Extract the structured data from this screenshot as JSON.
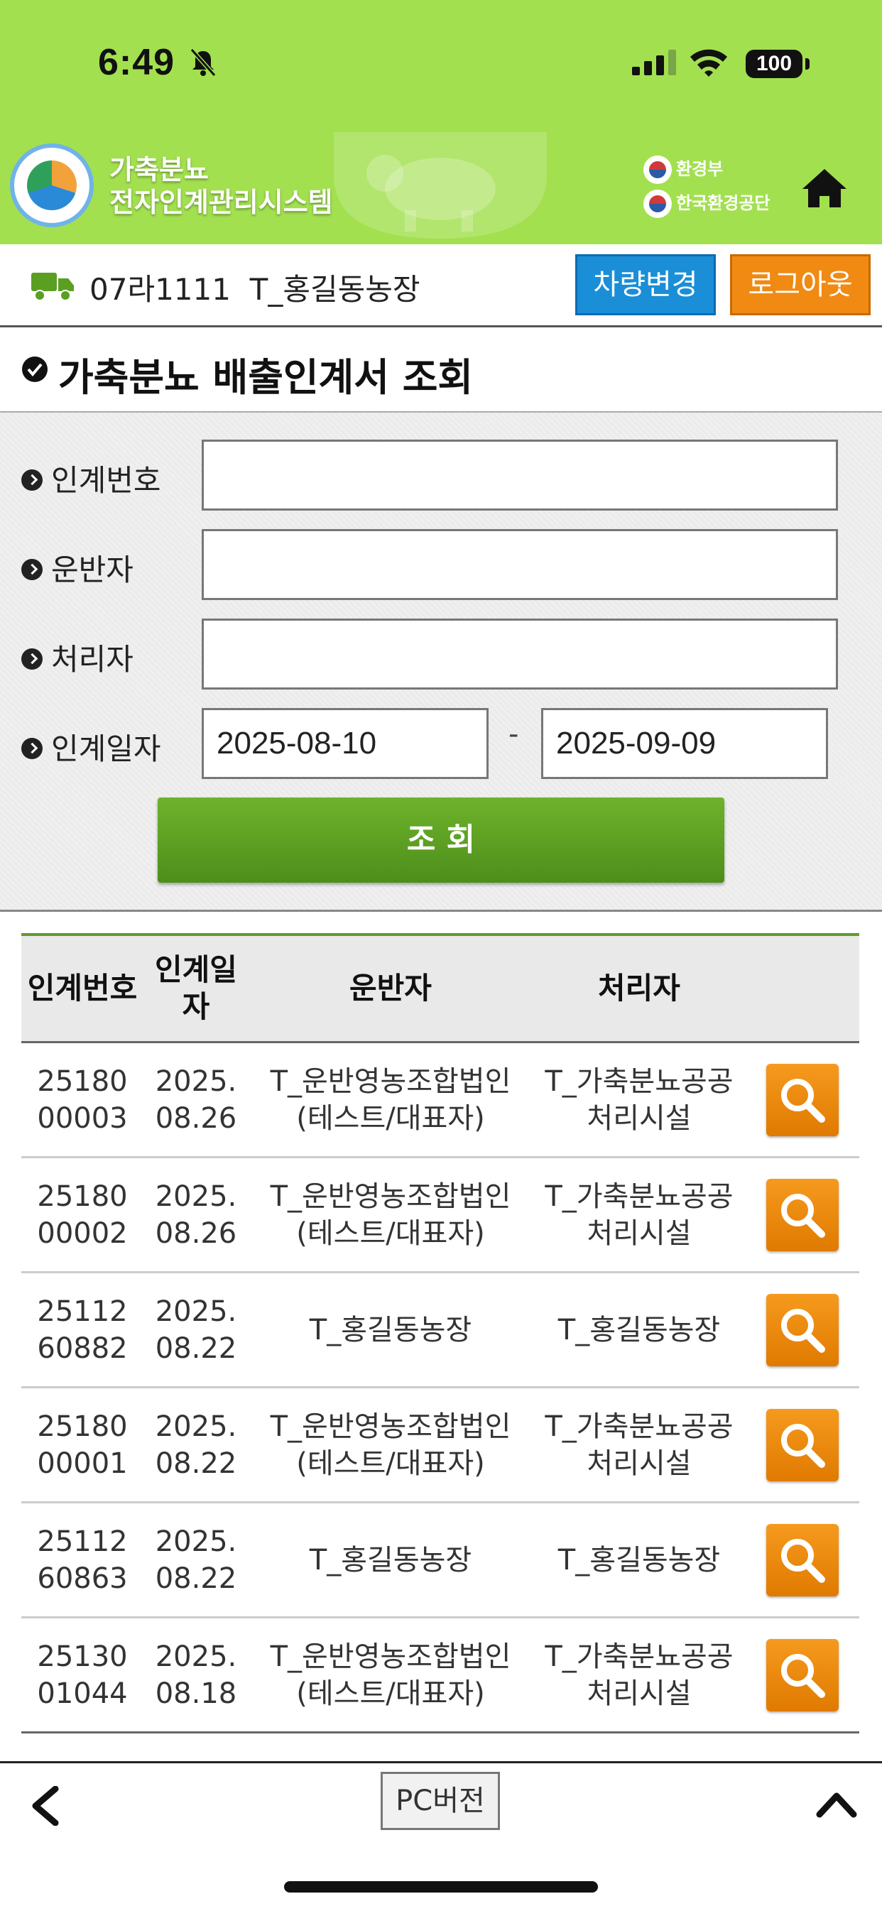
{
  "status_bar": {
    "time": "6:49",
    "battery": "100"
  },
  "header": {
    "system_title_line1": "가축분뇨",
    "system_title_line2": "전자인계관리시스템",
    "agency1": "환경부",
    "agency2": "한국환경공단"
  },
  "vehicle": {
    "info": "07라1111  T_홍길동농장",
    "change_button": "차량변경",
    "logout_button": "로그아웃"
  },
  "page": {
    "title": "가축분뇨 배출인계서 조회"
  },
  "search": {
    "label_number": "인계번호",
    "label_transporter": "운반자",
    "label_processor": "처리자",
    "label_date": "인계일자",
    "value_number": "",
    "value_transporter": "",
    "value_processor": "",
    "date_from": "2025-08-10",
    "date_sep": "-",
    "date_to": "2025-09-09",
    "submit_label": "조 회"
  },
  "table": {
    "headers": [
      "인계번호",
      "인계일자",
      "운반자",
      "처리자"
    ],
    "rows": [
      {
        "number": "2518000003",
        "date": "2025.08.26",
        "transporter": "T_운반영농조합법인(테스트/대표자)",
        "processor": "T_가축분뇨공공처리시설"
      },
      {
        "number": "2518000002",
        "date": "2025.08.26",
        "transporter": "T_운반영농조합법인(테스트/대표자)",
        "processor": "T_가축분뇨공공처리시설"
      },
      {
        "number": "2511260882",
        "date": "2025.08.22",
        "transporter": "T_홍길동농장",
        "processor": "T_홍길동농장"
      },
      {
        "number": "2518000001",
        "date": "2025.08.22",
        "transporter": "T_운반영농조합법인(테스트/대표자)",
        "processor": "T_가축분뇨공공처리시설"
      },
      {
        "number": "2511260863",
        "date": "2025.08.22",
        "transporter": "T_홍길동농장",
        "processor": "T_홍길동농장"
      },
      {
        "number": "2513001044",
        "date": "2025.08.18",
        "transporter": "T_운반영농조합법인(테스트/대표자)",
        "processor": "T_가축분뇨공공처리시설"
      }
    ]
  },
  "footer": {
    "pc_version": "PC버전"
  },
  "icons": {
    "view": "search-icon",
    "back": "chevron-left-icon",
    "top": "chevron-up-icon",
    "home": "home-icon"
  },
  "colors": {
    "header_green": "#a2e04f",
    "search_button": "#5a9e22",
    "change_button": "#1a8fd8",
    "logout_button": "#f08a12",
    "view_button": "#f08a12"
  }
}
